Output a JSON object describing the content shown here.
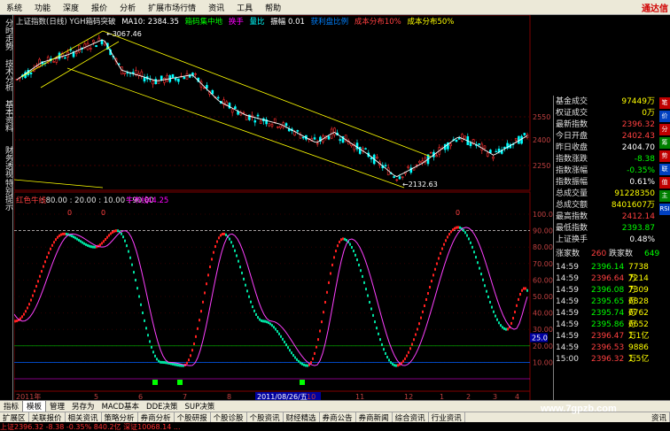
{
  "menu": {
    "items": [
      "系统",
      "功能",
      "深度",
      "报价",
      "分析",
      "扩展市场行情",
      "资讯",
      "工具",
      "帮助"
    ],
    "brand": "通达信"
  },
  "left_tabs": [
    "分时走势",
    "技术分析",
    "基本资料",
    "财务透视",
    "特别提示"
  ],
  "main_info": {
    "title": "上证指数(日线) YGH箱码突破",
    "ma": "MA10: 2384.35",
    "legend1": "箱码集中地",
    "legend2": "换手",
    "legend3": "量比",
    "legend4": "振幅 0.01",
    "legend5": "获利盘比例",
    "legend6": "成本分布10%",
    "legend7": "成本分布50%"
  },
  "price_labels": {
    "high": "3067.46",
    "low": "2132.63"
  },
  "price_axis": [
    "2550",
    "2400",
    "2250"
  ],
  "indicator": {
    "name": "红色牛线",
    "params": ": 80.00 : 20.00 : 10.00 : 90.00",
    "bull_label": "牛市线",
    "bull_value": "44.25",
    "axis": [
      "100.0",
      "90.00",
      "80.00",
      "70.00",
      "60.00",
      "50.00",
      "40.00",
      "30.00",
      "20.00",
      "10.00"
    ],
    "current": "25.0",
    "markers": [
      "0",
      "0",
      "0"
    ]
  },
  "date_axis": {
    "start": "2011年",
    "highlight": "2011/08/26/五",
    "months": [
      "5",
      "6",
      "7",
      "8",
      "10",
      "11",
      "12",
      "1",
      "2",
      "3",
      "4"
    ]
  },
  "quotes": [
    {
      "k": "基金成交",
      "v": "97449万",
      "c": "#ffff00"
    },
    {
      "k": "权证成交",
      "v": "0万",
      "c": "#ffff00"
    },
    {
      "k": "最新指数",
      "v": "2396.32",
      "c": "#ff4040"
    },
    {
      "k": "今日开盘",
      "v": "2402.43",
      "c": "#ff4040"
    },
    {
      "k": "昨日收盘",
      "v": "2404.70",
      "c": "#ffffff"
    },
    {
      "k": "指数涨跌",
      "v": "-8.38",
      "c": "#00ff00"
    },
    {
      "k": "指数涨幅",
      "v": "-0.35%",
      "c": "#00ff00"
    },
    {
      "k": "指数振幅",
      "v": "0.61%",
      "c": "#ffffff"
    },
    {
      "k": "总成交量",
      "v": "91228350",
      "c": "#ffff00"
    },
    {
      "k": "总成交额",
      "v": "8401607万",
      "c": "#ffff00"
    },
    {
      "k": "最高指数",
      "v": "2412.14",
      "c": "#ff4040"
    },
    {
      "k": "最低指数",
      "v": "2393.87",
      "c": "#00ff00"
    },
    {
      "k": "上证换手",
      "v": "0.48%",
      "c": "#ffffff"
    }
  ],
  "rise_fall": {
    "rise_label": "涨家数",
    "rise": "260",
    "fall_label": "跌家数",
    "fall": "649"
  },
  "ticks": [
    {
      "t": "14:59",
      "p": "2396.14",
      "v": "7738万"
    },
    {
      "t": "14:59",
      "p": "2396.64",
      "v": "7214万"
    },
    {
      "t": "14:59",
      "p": "2396.08",
      "v": "7309万"
    },
    {
      "t": "14:59",
      "p": "2395.65",
      "v": "6828万"
    },
    {
      "t": "14:59",
      "p": "2395.74",
      "v": "6762万"
    },
    {
      "t": "14:59",
      "p": "2395.86",
      "v": "6652万"
    },
    {
      "t": "14:59",
      "p": "2396.47",
      "v": "1.1亿"
    },
    {
      "t": "14:59",
      "p": "2396.53",
      "v": "9886万"
    },
    {
      "t": "15:00",
      "p": "2396.32",
      "v": "1.5亿"
    }
  ],
  "right_badges": [
    "笔",
    "价",
    "分",
    "筹",
    "势",
    "联",
    "值",
    "主",
    "RSI"
  ],
  "bottom_tabs": [
    "指标",
    "模板",
    "管理",
    "另存为",
    "MACD基本",
    "DDE决策",
    "SUP决策"
  ],
  "nav_tabs": [
    "扩展区",
    "关联报价",
    "相关资讯",
    "策略分析",
    "券商分析",
    "个股研报",
    "个股诊股",
    "个股资讯",
    "财经精选",
    "券商公告",
    "券商新闻",
    "综合资讯",
    "行业资讯"
  ],
  "right_tab": "资讯",
  "status_text": "上证2396.32  -8.38  -0.35%  840.2亿  深证10068.14  ...",
  "watermark": "www.7gpzb.com"
}
